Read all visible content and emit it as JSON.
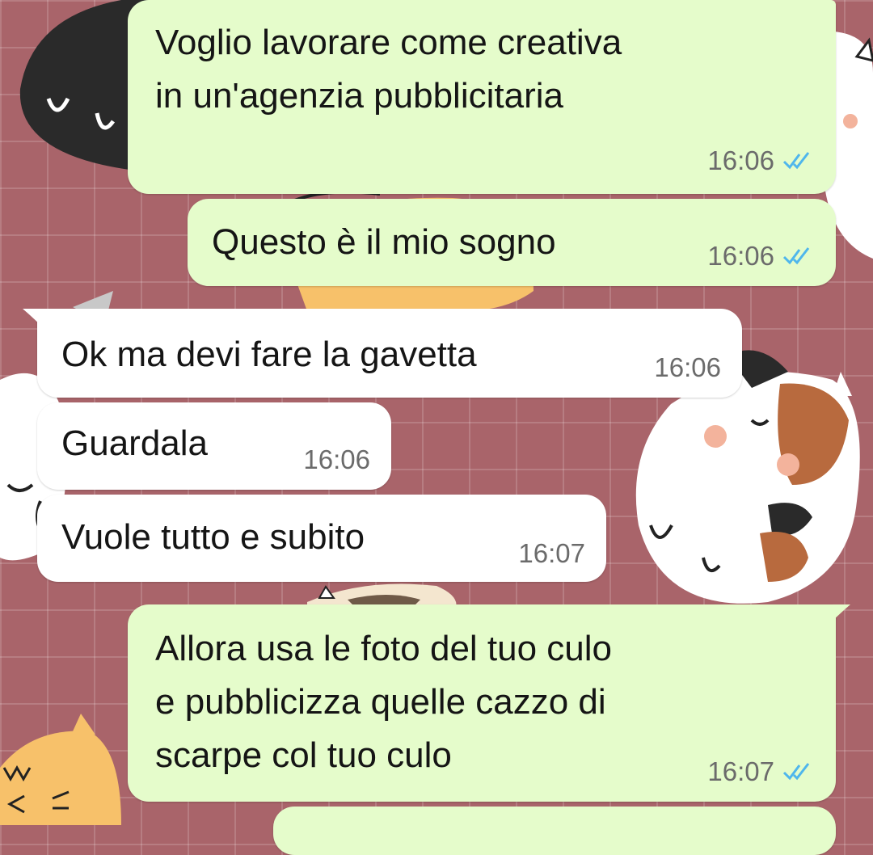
{
  "chat": {
    "messages": [
      {
        "dir": "out",
        "text": "Voglio lavorare come creativa\nin un'agenzia pubblicitaria",
        "time": "16:06",
        "ticks": "read-double-check-icon"
      },
      {
        "dir": "out",
        "text": "Questo è il mio sogno",
        "time": "16:06",
        "ticks": "read-double-check-icon"
      },
      {
        "dir": "in",
        "text": "Ok ma devi fare la gavetta",
        "time": "16:06"
      },
      {
        "dir": "in",
        "text": "Guardala",
        "time": "16:06"
      },
      {
        "dir": "in",
        "text": "Vuole tutto e subito",
        "time": "16:07"
      },
      {
        "dir": "out",
        "text": "Allora usa le foto del tuo culo\ne pubblicizza quelle cazzo di\nscarpe col tuo culo",
        "time": "16:07",
        "ticks": "read-double-check-icon"
      }
    ]
  },
  "colors": {
    "background": "#a9646a",
    "outgoing_bubble": "#e5fccb",
    "incoming_bubble": "#ffffff",
    "read_tick": "#4fb6ec",
    "timestamp": "#6b6b6b"
  },
  "wallpaper": {
    "pattern": "cartoon-cats-on-grid"
  }
}
